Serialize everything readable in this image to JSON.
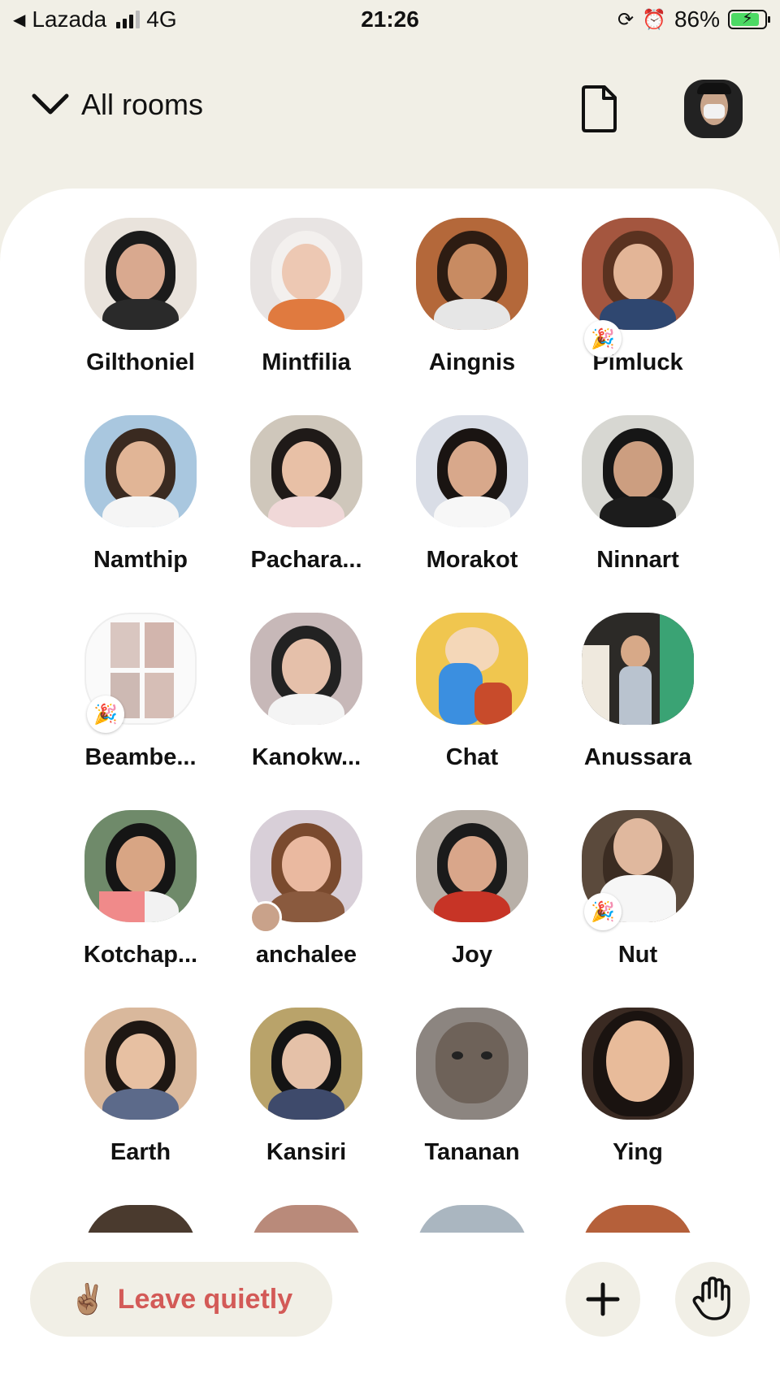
{
  "status_bar": {
    "back_glyph": "◀",
    "back_app": "Lazada",
    "network": "4G",
    "time": "21:26",
    "battery": "86%",
    "battery_level": 0.86,
    "icons": [
      "orientation-lock-icon",
      "alarm-icon"
    ]
  },
  "header": {
    "title": "All rooms",
    "chevron_icon": "chevron-down-icon",
    "doc_icon": "document-icon"
  },
  "people": [
    {
      "name": "Gilthoniel"
    },
    {
      "name": "Mintfilia"
    },
    {
      "name": "Aingnis"
    },
    {
      "name": "Pimluck",
      "badge": "🎉"
    },
    {
      "name": "Namthip"
    },
    {
      "name": "Pachara..."
    },
    {
      "name": "Morakot"
    },
    {
      "name": "Ninnart"
    },
    {
      "name": "Beambe...",
      "badge": "🎉"
    },
    {
      "name": "Kanokw..."
    },
    {
      "name": "Chat"
    },
    {
      "name": "Anussara"
    },
    {
      "name": "Kotchap..."
    },
    {
      "name": "anchalee"
    },
    {
      "name": "Joy"
    },
    {
      "name": "Nut",
      "badge": "🎉"
    },
    {
      "name": "Earth"
    },
    {
      "name": "Kansiri"
    },
    {
      "name": "Tananan"
    },
    {
      "name": "Ying"
    }
  ],
  "bottom_bar": {
    "leave_emoji": "✌🏽",
    "leave_label": "Leave quietly",
    "add_icon": "plus-icon",
    "hand_icon": "raised-hand-icon"
  },
  "colors": {
    "background": "#f1efe6",
    "sheet": "#ffffff",
    "leave_text": "#d35a57",
    "battery_fill": "#4cd964"
  }
}
